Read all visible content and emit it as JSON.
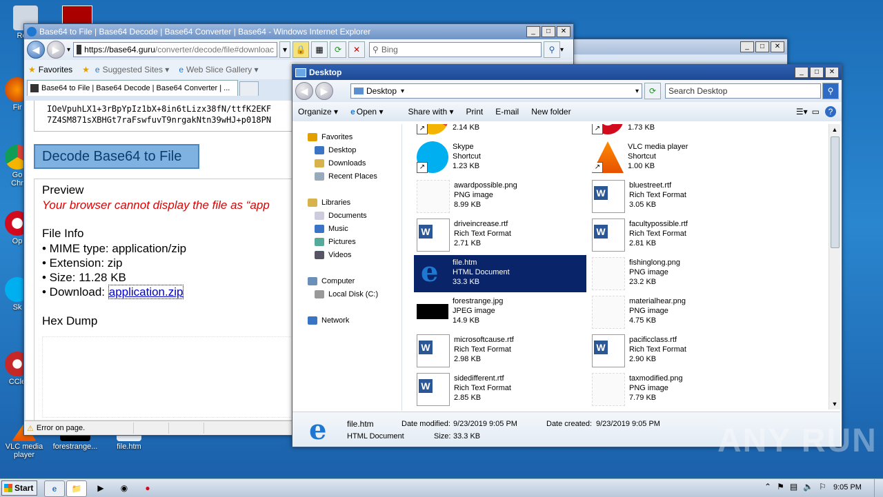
{
  "desktop": {
    "icons_left": [
      "Recy",
      "Fir",
      "Go\nChr",
      "Op",
      "Sk",
      "CCle"
    ],
    "icons_bottom": [
      {
        "label": "VLC media\nplayer"
      },
      {
        "label": "forestrange..."
      },
      {
        "label": "file.htm"
      }
    ],
    "watermark": "ANY RUN"
  },
  "ie": {
    "title": "Base64 to File | Base64 Decode | Base64 Converter | Base64 - Windows Internet Explorer",
    "address_host": "https://base64.guru",
    "address_path": "/converter/decode/file#downloac",
    "search_placeholder": "Bing",
    "fav_label": "Favorites",
    "suggested": "Suggested Sites ▾",
    "webslice": "Web Slice Gallery ▾",
    "tab_title": "Base64 to File | Base64 Decode | Base64 Converter | ...",
    "code_line1": "IOeVpuhLX1+3rBpYpIz1bX+8in6tLizx38fN/ttfK2EKF",
    "code_line2": "7Z4SM871sXBHGt7raFswfuvT9nrgakNtn39wHJ+p018PN",
    "decode_button": "Decode Base64 to File",
    "preview_heading": "Preview",
    "preview_error": "Your browser cannot display the file as “app",
    "fileinfo_heading": "File Info",
    "mime": "• MIME type: application/zip",
    "ext": "• Extension: zip",
    "size": "• Size: 11.28 KB",
    "download_label": "• Download: ",
    "download_link": "application.zip",
    "hex_heading": "Hex Dump",
    "status": "Error on page."
  },
  "explorer": {
    "title": "Desktop",
    "breadcrumb": "Desktop",
    "search_placeholder": "Search Desktop",
    "commands": [
      "Organize ▾",
      "Open ▾",
      "Share with ▾",
      "Print",
      "E-mail",
      "New folder"
    ],
    "nav": {
      "favorites": "Favorites",
      "desktop": "Desktop",
      "downloads": "Downloads",
      "recent": "Recent Places",
      "libraries": "Libraries",
      "documents": "Documents",
      "music": "Music",
      "pictures": "Pictures",
      "videos": "Videos",
      "computer": "Computer",
      "localdisk": "Local Disk (C:)",
      "network": "Network"
    },
    "files": [
      {
        "name": "",
        "type": "",
        "size": "2.14 KB"
      },
      {
        "name": "",
        "type": "",
        "size": "1.73 KB"
      },
      {
        "name": "Skype",
        "type": "Shortcut",
        "size": "1.23 KB"
      },
      {
        "name": "VLC media player",
        "type": "Shortcut",
        "size": "1.00 KB"
      },
      {
        "name": "awardpossible.png",
        "type": "PNG image",
        "size": "8.99 KB"
      },
      {
        "name": "bluestreet.rtf",
        "type": "Rich Text Format",
        "size": "3.05 KB"
      },
      {
        "name": "driveincrease.rtf",
        "type": "Rich Text Format",
        "size": "2.71 KB"
      },
      {
        "name": "facultypossible.rtf",
        "type": "Rich Text Format",
        "size": "2.81 KB"
      },
      {
        "name": "file.htm",
        "type": "HTML Document",
        "size": "33.3 KB"
      },
      {
        "name": "fishinglong.png",
        "type": "PNG image",
        "size": "23.2 KB"
      },
      {
        "name": "forestrange.jpg",
        "type": "JPEG image",
        "size": "14.9 KB"
      },
      {
        "name": "materialhear.png",
        "type": "PNG image",
        "size": "4.75 KB"
      },
      {
        "name": "microsoftcause.rtf",
        "type": "Rich Text Format",
        "size": "2.98 KB"
      },
      {
        "name": "pacificclass.rtf",
        "type": "Rich Text Format",
        "size": "2.90 KB"
      },
      {
        "name": "sidedifferent.rtf",
        "type": "Rich Text Format",
        "size": "2.85 KB"
      },
      {
        "name": "taxmodified.png",
        "type": "PNG image",
        "size": "7.79 KB"
      }
    ],
    "details": {
      "name": "file.htm",
      "type": "HTML Document",
      "modified_label": "Date modified:",
      "modified": "9/23/2019 9:05 PM",
      "created_label": "Date created:",
      "created": "9/23/2019 9:05 PM",
      "size_label": "Size:",
      "size": "33.3 KB"
    }
  },
  "taskbar": {
    "start": "Start",
    "clock": "9:05 PM"
  }
}
